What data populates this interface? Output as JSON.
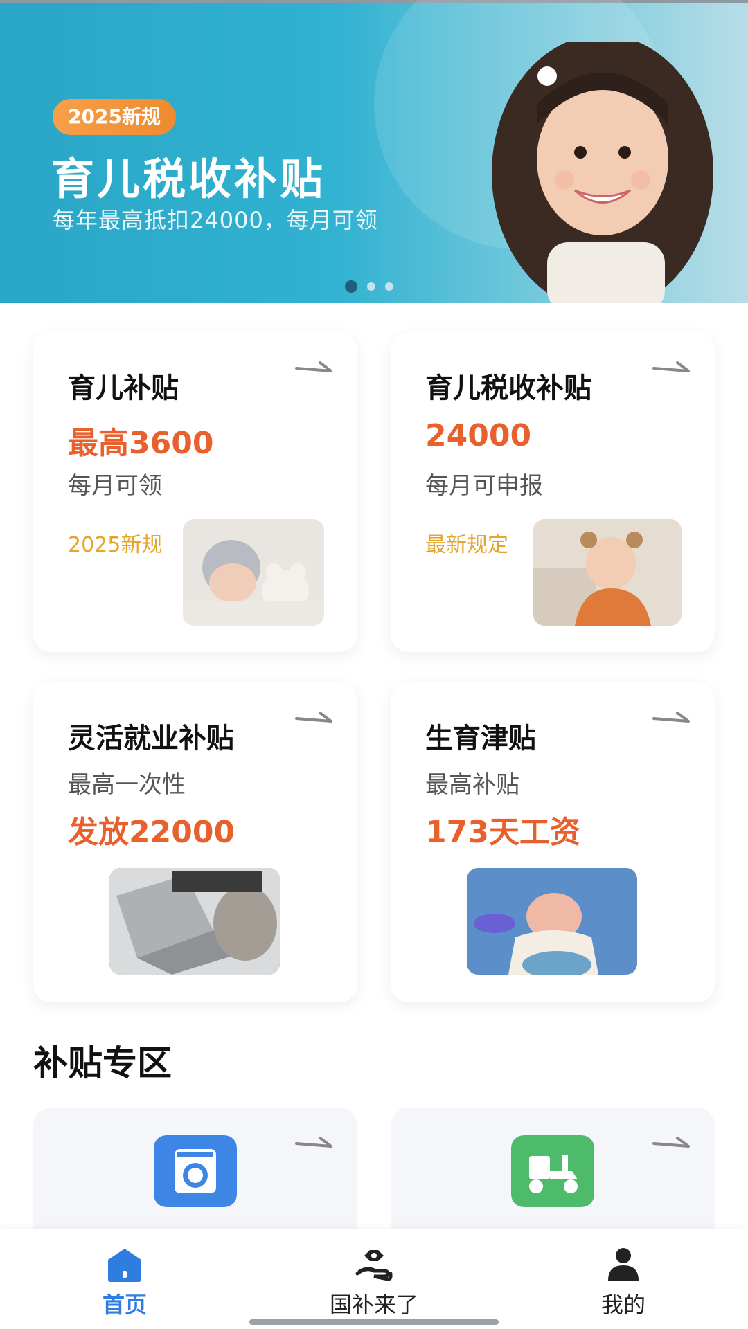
{
  "banner": {
    "tag": "2025新规",
    "title": "育儿税收补贴",
    "subtitle": "每年最高抵扣24000，每月可领",
    "dots": 3,
    "active_dot": 1
  },
  "cards": [
    {
      "title": "育儿补贴",
      "highlight": "最高3600",
      "desc": "每月可领",
      "note": "2025新规",
      "image": "sleeping-baby"
    },
    {
      "title": "育儿税收补贴",
      "highlight": "24000",
      "desc": "每月可申报",
      "note": "最新规定",
      "image": "toddler-girl"
    },
    {
      "title": "灵活就业补贴",
      "desc": "最高一次性",
      "highlight": "发放22000",
      "image": "laptop-typing"
    },
    {
      "title": "生育津贴",
      "desc": "最高补贴",
      "highlight": "173天工资",
      "image": "newborn-delivery"
    }
  ],
  "section": {
    "title": "补贴专区"
  },
  "zone_items": [
    {
      "icon": "washing-machine-icon",
      "color": "#3d86e6"
    },
    {
      "icon": "scooter-icon",
      "color": "#4dbb6a"
    }
  ],
  "nav": {
    "items": [
      {
        "label": "首页",
        "icon": "home-icon",
        "active": true
      },
      {
        "label": "国补来了",
        "icon": "subsidy-hand-icon",
        "active": false
      },
      {
        "label": "我的",
        "icon": "user-icon",
        "active": false
      }
    ]
  },
  "colors": {
    "accent": "#e8602c",
    "note": "#e4a52a",
    "nav_active": "#2f7de1",
    "banner_bg": "#31b2d1"
  }
}
